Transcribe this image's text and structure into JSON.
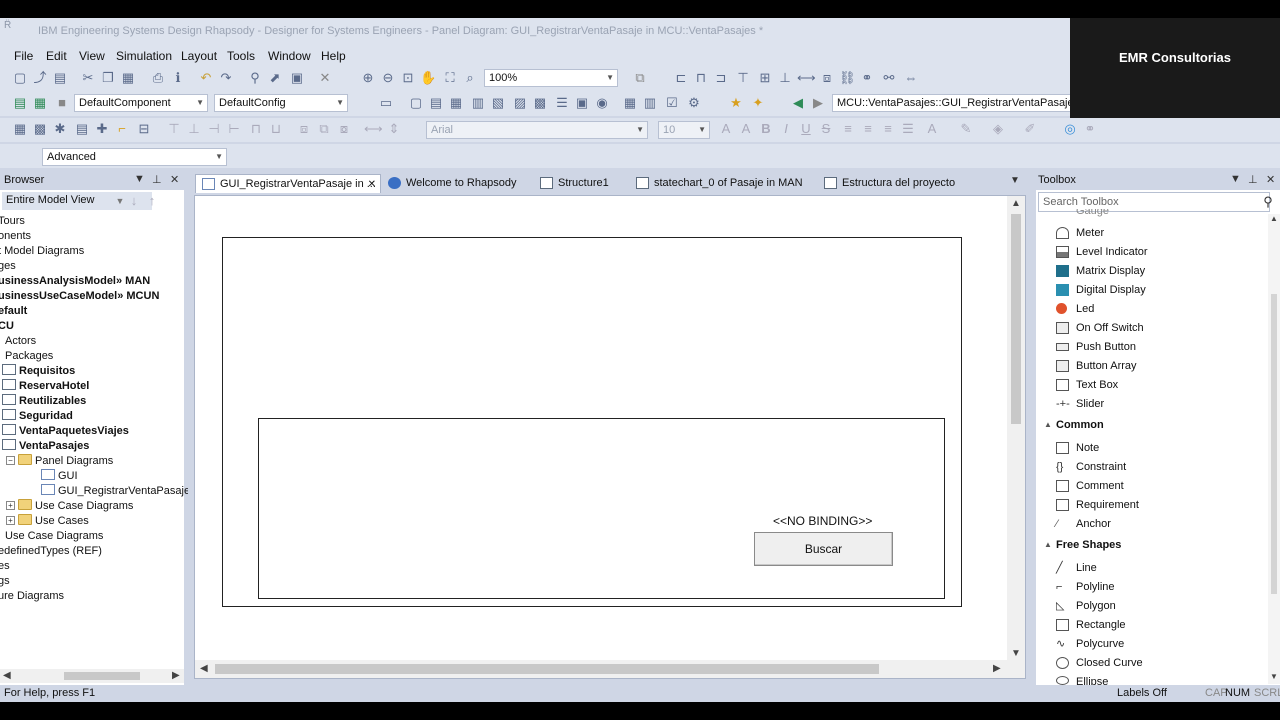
{
  "window": {
    "title": "IBM Engineering Systems Design Rhapsody - Designer for Systems Engineers - Panel Diagram: GUI_RegistrarVentaPasaje in MCU::VentaPasajes *"
  },
  "overlay": {
    "brand": "EMR Consultorias"
  },
  "menu": [
    "File",
    "Edit",
    "View",
    "Simulation",
    "Layout",
    "Tools",
    "Window",
    "Help"
  ],
  "toolbar": {
    "zoom": "100%",
    "component": "DefaultComponent",
    "config": "DefaultConfig",
    "path": "MCU::VentaPasajes::GUI_RegistrarVentaPasaje",
    "font": "Arial",
    "font_size": "10",
    "mode": "Advanced"
  },
  "browser": {
    "title": "Browser",
    "view": "Entire Model View",
    "items": [
      "Tours",
      "onents",
      "t Model Diagrams",
      "ges",
      "usinessAnalysisModel» MAN",
      "usinessUseCaseModel» MCUN",
      "efault",
      "CU",
      "Actors",
      "Packages",
      "Requisitos",
      "ReservaHotel",
      "Reutilizables",
      "Seguridad",
      "VentaPaquetesViajes",
      "VentaPasajes",
      "Panel Diagrams",
      "GUI",
      "GUI_RegistrarVentaPasaje",
      "Use Case Diagrams",
      "Use Cases",
      "Use Case Diagrams",
      "edefinedTypes (REF)",
      "es",
      "gs",
      "ure Diagrams"
    ]
  },
  "tabs": [
    "GUI_RegistrarVentaPasaje in ...",
    "Welcome to Rhapsody",
    "Structure1",
    "statechart_0 of Pasaje in MAN",
    "Estructura del proyecto"
  ],
  "canvas": {
    "binding_label": "<<NO BINDING>>",
    "button_label": "Buscar"
  },
  "toolbox": {
    "title": "Toolbox",
    "search_placeholder": "Search Toolbox",
    "partial_top": "Gauge",
    "items": [
      "Meter",
      "Level Indicator",
      "Matrix Display",
      "Digital Display",
      "Led",
      "On Off Switch",
      "Push Button",
      "Button Array",
      "Text Box",
      "Slider"
    ],
    "group_common": "Common",
    "common_items": [
      "Note",
      "Constraint",
      "Comment",
      "Requirement",
      "Anchor"
    ],
    "group_shapes": "Free Shapes",
    "shape_items": [
      "Line",
      "Polyline",
      "Polygon",
      "Rectangle",
      "Polycurve",
      "Closed Curve",
      "Ellipse"
    ]
  },
  "status": {
    "help": "For Help, press F1",
    "labels": "Labels Off",
    "caps": "CAP",
    "num": "NUM",
    "scrl": "SCRL"
  },
  "colors": {
    "folder": "#f1d27a",
    "led": "#e0522c",
    "accent": "#3a6fc4"
  }
}
